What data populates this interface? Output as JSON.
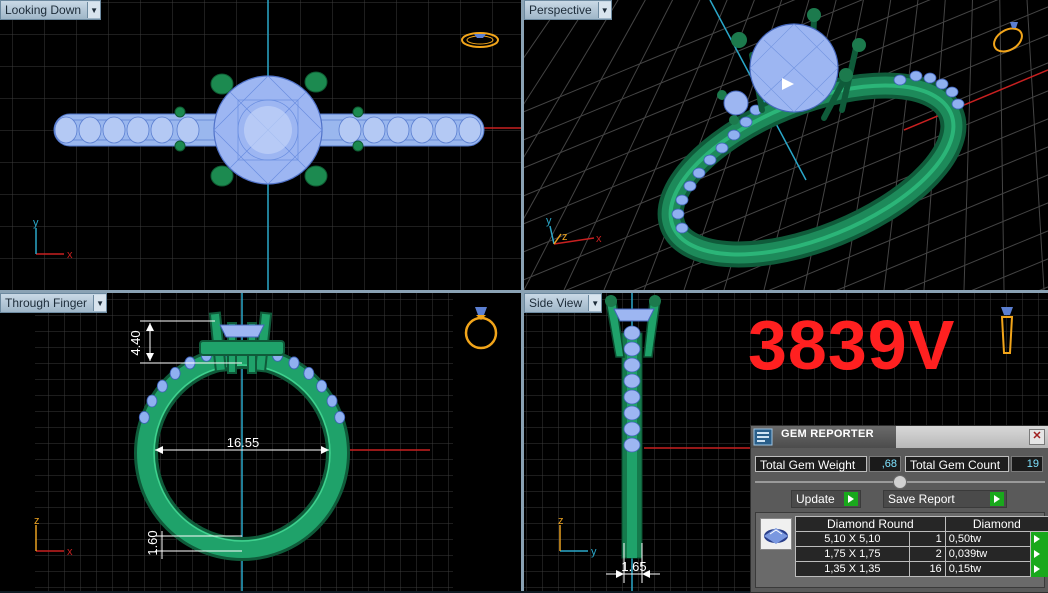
{
  "viewports": {
    "top": {
      "label": "Looking Down"
    },
    "persp": {
      "label": "Perspective"
    },
    "front": {
      "label": "Through Finger"
    },
    "side": {
      "label": "Side View"
    }
  },
  "axes": {
    "x": "x",
    "y": "y",
    "z": "z"
  },
  "dimensions": {
    "prong_height": "4.40",
    "inner_diameter": "16.55",
    "shank_thickness": "1.60",
    "shank_width": "1.65"
  },
  "model_code": "3839V",
  "colors": {
    "metal": "#1fa26a",
    "gem": "#9cb6f0",
    "code": "#ff2020",
    "cube": "#f2a51a"
  },
  "gem_reporter": {
    "title": "GEM REPORTER",
    "close_icon": "close-icon",
    "weight_label": "Total Gem Weight",
    "weight_value": ",68",
    "count_label": "Total Gem Count",
    "count_value": "19",
    "update_label": "Update",
    "save_label": "Save Report",
    "table_header_shape": "Diamond Round",
    "table_header_type": "Diamond",
    "rows": [
      {
        "size": "5,10 X 5,10",
        "qty": "1",
        "tw": "0,50tw"
      },
      {
        "size": "1,75 X 1,75",
        "qty": "2",
        "tw": "0,039tw"
      },
      {
        "size": "1,35 X 1,35",
        "qty": "16",
        "tw": "0,15tw"
      }
    ]
  }
}
